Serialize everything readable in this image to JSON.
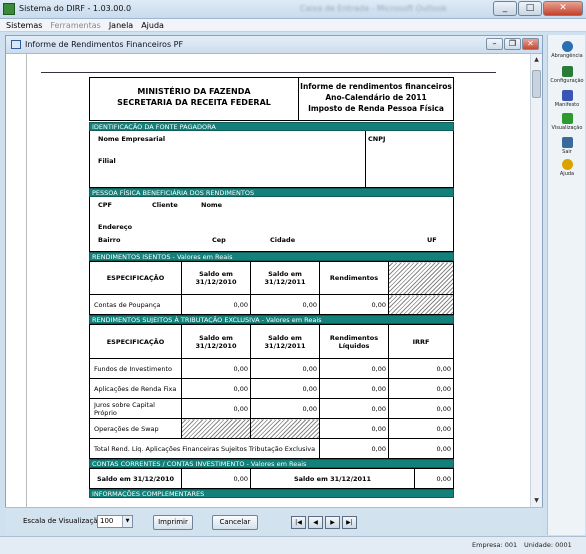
{
  "window": {
    "title": "Sistema do DIRF - 1.03.00.0",
    "blurred_title": "Caixa de Entrada - Microsoft Outlook"
  },
  "menu": [
    {
      "label": "Sistemas",
      "disabled": false
    },
    {
      "label": "Ferramentas",
      "disabled": true
    },
    {
      "label": "Janela",
      "disabled": false
    },
    {
      "label": "Ajuda",
      "disabled": false
    }
  ],
  "inner_window": {
    "title": "Informe de Rendimentos Financeiros PF"
  },
  "doc": {
    "header_left_1": "MINISTÉRIO DA FAZENDA",
    "header_left_2": "SECRETARIA DA RECEITA FEDERAL",
    "header_right_1": "Informe de rendimentos financeiros",
    "header_right_2": "Ano-Calendário de 2011",
    "header_right_3": "Imposto de Renda Pessoa Física",
    "sec1": "IDENTIFICAÇÃO DA FONTE PAGADORA",
    "nome_empresarial": "Nome Empresarial",
    "cnpj": "CNPJ",
    "filial": "Filial",
    "sec2": "PESSOA FÍSICA  BENEFICIÁRIA DOS RENDIMENTOS",
    "cpf": "CPF",
    "cliente": "Cliente",
    "nome": "Nome",
    "endereco": "Endereço",
    "bairro": "Bairro",
    "cep": "Cep",
    "cidade": "Cidade",
    "uf": "UF",
    "sec3": "RENDIMENTOS ISENTOS - Valores em Reais",
    "t1": {
      "h_esp": "ESPECIFICAÇÃO",
      "h_saldo1": "Saldo em 31/12/2010",
      "h_saldo2": "Saldo em 31/12/2011",
      "h_rend": "Rendimentos",
      "row_label": "Contas de Poupança",
      "v1": "0,00",
      "v2": "0,00",
      "v3": "0,00"
    },
    "sec4": "RENDIMENTOS SUJEITOS À TRIBUTAÇÃO EXCLUSIVA - Valores em Reais",
    "t2": {
      "h_esp": "ESPECIFICAÇÃO",
      "h_saldo1": "Saldo em 31/12/2010",
      "h_saldo2": "Saldo em 31/12/2011",
      "h_rend": "Rendimentos Líquidos",
      "h_irrf": "IRRF",
      "r1": "Fundos de Investimento",
      "r2": "Aplicações de Renda Fixa",
      "r3": "Juros sobre Capital Próprio",
      "r4": "Operações de Swap",
      "r5": "Total Rend. Líq. Aplicações Financeiras Sujeitos Tributação Exclusiva",
      "zero": "0,00"
    },
    "sec5": "CONTAS CORRENTES / CONTAS INVESTIMENTO - Valores em Reais",
    "saldo2010": "Saldo em 31/12/2010",
    "saldo2010_val": "0,00",
    "saldo2011": "Saldo em 31/12/2011",
    "saldo2011_val": "0,00",
    "sec6": "INFORMAÇÕES COMPLEMENTARES"
  },
  "sidebar": [
    {
      "label": "Abrangência",
      "icon": "globe-icon",
      "color": "#2c6fb0"
    },
    {
      "label": "Configuração",
      "icon": "grid-icon",
      "color": "#2a7a3a"
    },
    {
      "label": "Manifesto",
      "icon": "network-icon",
      "color": "#3a55b4"
    },
    {
      "label": "Visualização",
      "icon": "flag-icon",
      "color": "#2d9a2d"
    },
    {
      "label": "Sair",
      "icon": "exit-icon",
      "color": "#3a6a9a"
    },
    {
      "label": "Ajuda",
      "icon": "help-icon",
      "color": "#d9a300"
    }
  ],
  "controls": {
    "zoom_label": "Escala de Visualização",
    "zoom_value": "100",
    "print": "Imprimir",
    "cancel": "Cancelar",
    "first": "|◀",
    "prev": "◀",
    "next": "▶",
    "last": "▶|"
  },
  "status": {
    "empresa": "Empresa: 001",
    "unidade": "Unidade: 0001"
  }
}
